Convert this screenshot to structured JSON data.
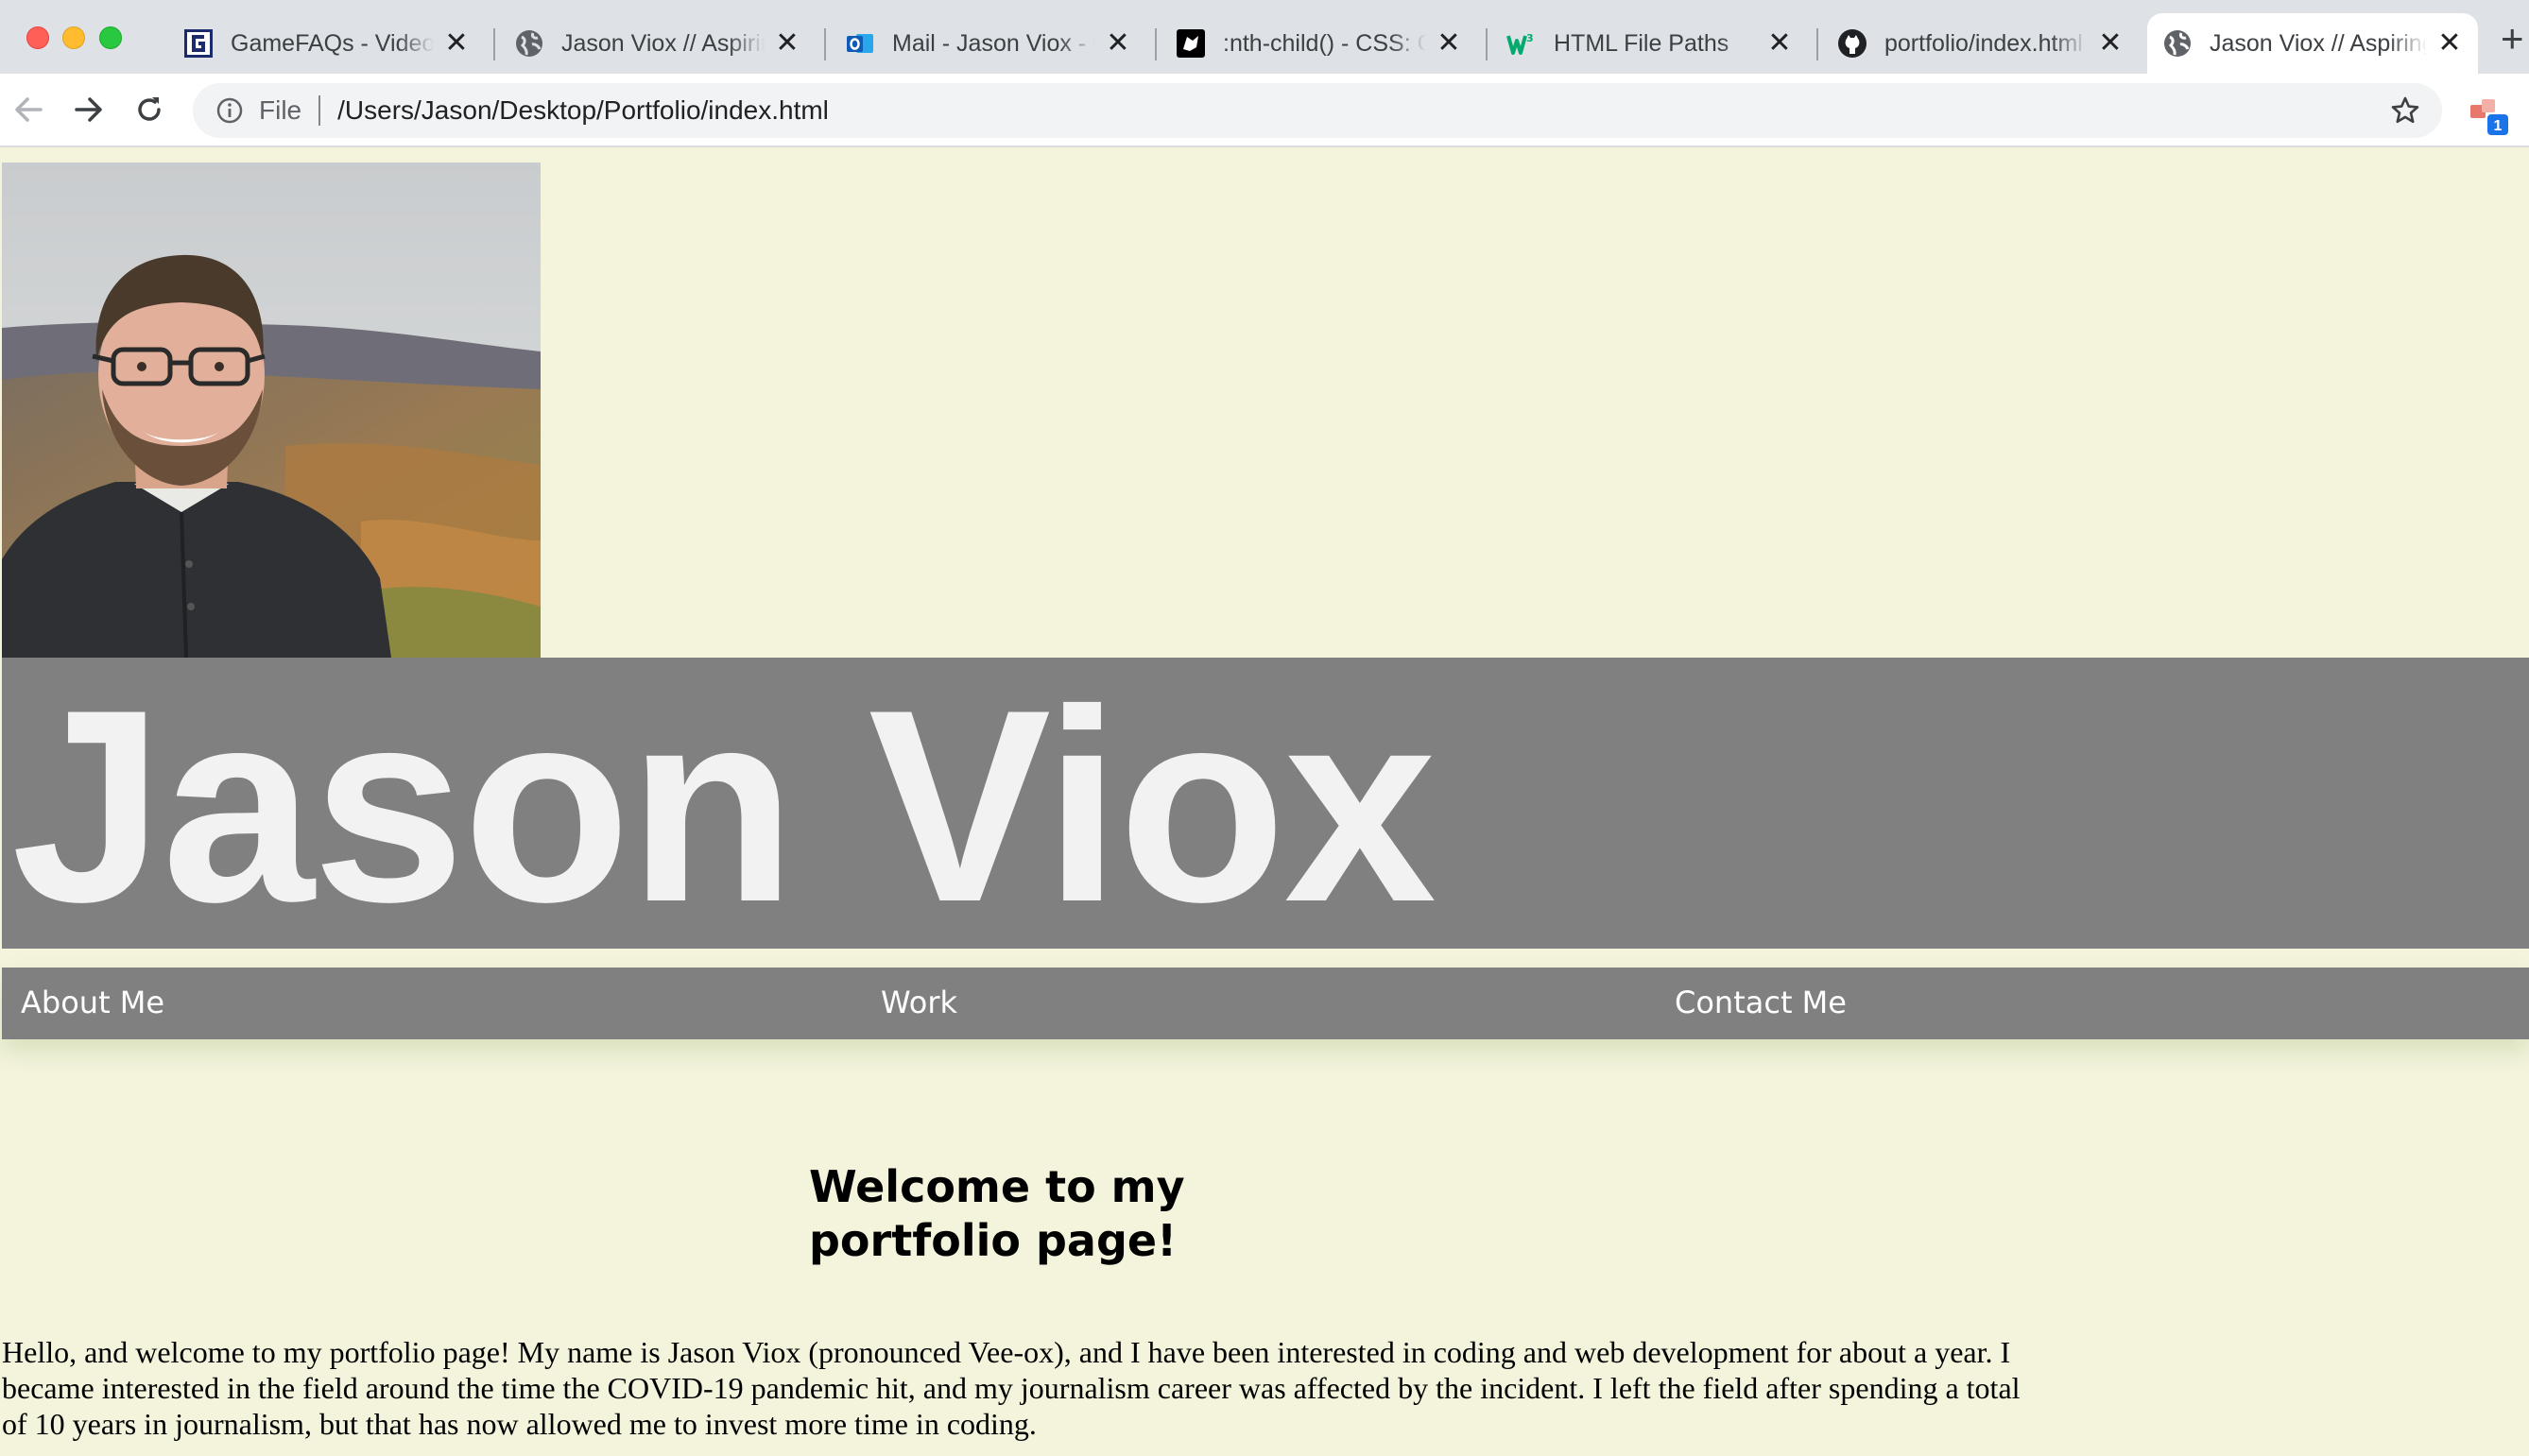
{
  "browser": {
    "tabs": [
      {
        "title": "GameFAQs - Video Game Cheats, Reviews, FAQs",
        "icon": "gamefaqs-icon",
        "active": false
      },
      {
        "title": "Jason Viox // Aspiring Web Developer",
        "icon": "globe-icon",
        "active": false
      },
      {
        "title": "Mail - Jason Viox - Outlook",
        "icon": "outlook-icon",
        "active": false
      },
      {
        "title": ":nth-child() - CSS: Cascading Style Sheets | MDN",
        "icon": "mdn-icon",
        "active": false
      },
      {
        "title": "HTML File Paths",
        "icon": "w3schools-icon",
        "active": false
      },
      {
        "title": "portfolio/index.html at main",
        "icon": "github-icon",
        "active": false
      },
      {
        "title": "Jason Viox // Aspiring Web Developer",
        "icon": "globe-icon",
        "active": true
      }
    ],
    "new_tab_label": "+",
    "close_glyph": "✕",
    "address_bar": {
      "scheme_label": "File",
      "url": "/Users/Jason/Desktop/Portfolio/index.html"
    },
    "extension_badge": "1"
  },
  "page": {
    "header_name": "Jason Viox",
    "nav": {
      "about": "About Me",
      "work": "Work",
      "contact": "Contact Me"
    },
    "welcome_heading": "Welcome to my portfolio page!",
    "intro_paragraph": "Hello, and welcome to my portfolio page! My name is Jason Viox (pronounced Vee-ox), and I have been interested in coding and web development for about a year. I became interested in the field around the time the COVID-19 pandemic hit, and my journalism career was affected by the incident. I left the field after spending a total of 10 years in journalism, but that has now allowed me to invest more time in coding."
  },
  "colors": {
    "page_background": "#f4f4dc",
    "banner_gray": "#808080",
    "banner_text": "#f2f2f2",
    "nav_text": "#ffffff"
  }
}
